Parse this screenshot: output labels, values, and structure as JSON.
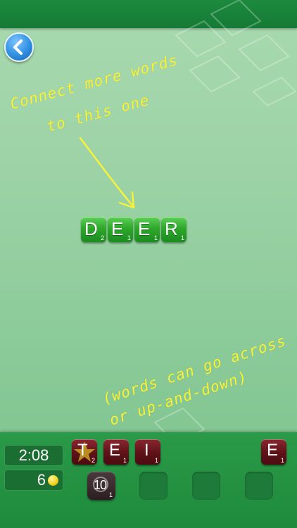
{
  "icons": {
    "back": "chevron-left-icon",
    "coin": "coin-icon",
    "star": "star-icon"
  },
  "colors": {
    "header": "#1c8a3e",
    "board_tile": "#2ea82b",
    "rack_tile": "#5e1218",
    "hint_text": "#f7f23a",
    "back_button": "#2f8fe0"
  },
  "hints": {
    "top_line1": "Connect more words",
    "top_line2": "to this one",
    "bottom_line1": "(words can go across",
    "bottom_line2": "or up-and-down)"
  },
  "board": {
    "word": [
      {
        "letter": "D",
        "points": "2"
      },
      {
        "letter": "E",
        "points": "1"
      },
      {
        "letter": "E",
        "points": "1"
      },
      {
        "letter": "R",
        "points": "1"
      }
    ]
  },
  "status": {
    "timer": "2:08",
    "coins": "6"
  },
  "rack": {
    "tiles": [
      {
        "letter": "T",
        "points": "2",
        "bonus": "star"
      },
      {
        "letter": "E",
        "points": "1"
      },
      {
        "letter": "I",
        "points": "1"
      },
      {
        "letter": "E",
        "points": "1"
      }
    ],
    "bonus_tile": {
      "number": "10",
      "points": "1"
    }
  }
}
